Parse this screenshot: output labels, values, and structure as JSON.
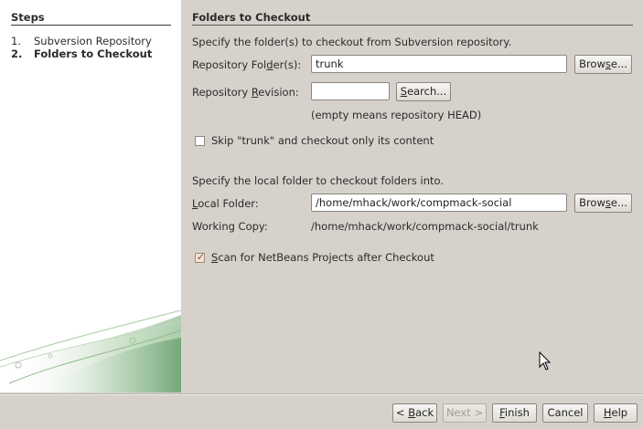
{
  "steps": {
    "title": "Steps",
    "items": [
      {
        "num": "1.",
        "label": "Subversion Repository",
        "current": false
      },
      {
        "num": "2.",
        "label": "Folders to Checkout",
        "current": true
      }
    ]
  },
  "main": {
    "title": "Folders to Checkout",
    "intro": "Specify the folder(s) to checkout from Subversion repository.",
    "repo_folder": {
      "label_pre": "Repository Fol",
      "label_mn": "d",
      "label_post": "er(s):",
      "value": "trunk",
      "browse_pre": "Brow",
      "browse_mn": "s",
      "browse_post": "e..."
    },
    "repo_revision": {
      "label_pre": "Repository ",
      "label_mn": "R",
      "label_post": "evision:",
      "value": "",
      "search_pre": "",
      "search_mn": "S",
      "search_post": "earch..."
    },
    "revision_hint": "(empty means repository HEAD)",
    "skip": {
      "label": "Skip \"trunk\" and checkout only its content",
      "checked": false
    },
    "local_intro": "Specify the local folder to checkout folders into.",
    "local_folder": {
      "label_pre": "",
      "label_mn": "L",
      "label_post": "ocal Folder:",
      "value": "/home/mhack/work/compmack-social",
      "browse_pre": "Brow",
      "browse_mn": "s",
      "browse_post": "e..."
    },
    "working_copy": {
      "label": "Working Copy:",
      "value": "/home/mhack/work/compmack-social/trunk"
    },
    "scan": {
      "label_pre": "S",
      "label_post": "can for NetBeans Projects after Checkout",
      "checked": true
    }
  },
  "footer": {
    "back_pre": "< ",
    "back_mn": "B",
    "back_post": "ack",
    "next": "Next >",
    "finish_pre": "",
    "finish_mn": "F",
    "finish_post": "inish",
    "cancel": "Cancel",
    "help_pre": "",
    "help_mn": "H",
    "help_post": "elp"
  }
}
